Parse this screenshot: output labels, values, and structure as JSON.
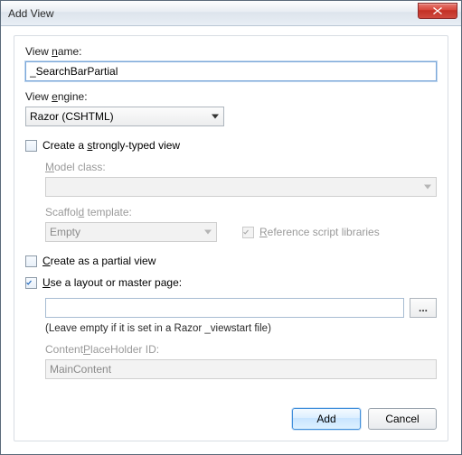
{
  "window": {
    "title": "Add View"
  },
  "fields": {
    "view_name_label": "View name:",
    "view_name_value": "_SearchBarPartial",
    "view_engine_label": "View engine:",
    "view_engine_value": "Razor (CSHTML)"
  },
  "strongly_typed": {
    "checkbox_label": "Create a strongly-typed view",
    "checked": false,
    "model_class_label": "Model class:",
    "model_class_value": "",
    "scaffold_label": "Scaffold template:",
    "scaffold_value": "Empty",
    "reference_scripts_label": "Reference script libraries",
    "reference_scripts_checked": true
  },
  "partial": {
    "checkbox_label": "Create as a partial view",
    "checked": false
  },
  "layout": {
    "checkbox_label": "Use a layout or master page:",
    "checked": true,
    "path_value": "",
    "browse_label": "...",
    "note": "(Leave empty if it is set in a Razor _viewstart file)",
    "cph_label": "ContentPlaceHolder ID:",
    "cph_value": "MainContent"
  },
  "buttons": {
    "add": "Add",
    "cancel": "Cancel"
  }
}
